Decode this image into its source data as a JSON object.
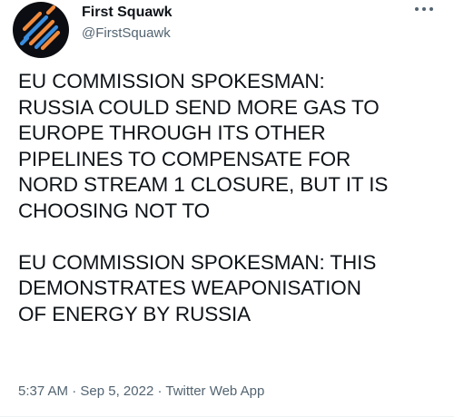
{
  "author": {
    "display_name": "First Squawk",
    "handle": "@FirstSquawk",
    "avatar_icon": "first-squawk-logo",
    "avatar_colors": [
      "#f08a3c",
      "#3b8ede",
      "#0b0d12"
    ]
  },
  "menu_icon": "more-dots-icon",
  "tweet": {
    "paragraphs": [
      "EU COMMISSION SPOKESMAN:\nRUSSIA COULD SEND MORE GAS TO\nEUROPE THROUGH ITS OTHER\nPIPELINES TO COMPENSATE FOR\nNORD STREAM 1 CLOSURE, BUT IT IS\nCHOOSING NOT TO",
      "EU COMMISSION SPOKESMAN: THIS\nDEMONSTRATES WEAPONISATION\nOF ENERGY BY RUSSIA"
    ],
    "time": "5:37 AM",
    "separator": " · ",
    "date": "Sep 5, 2022",
    "source": "Twitter Web App"
  }
}
